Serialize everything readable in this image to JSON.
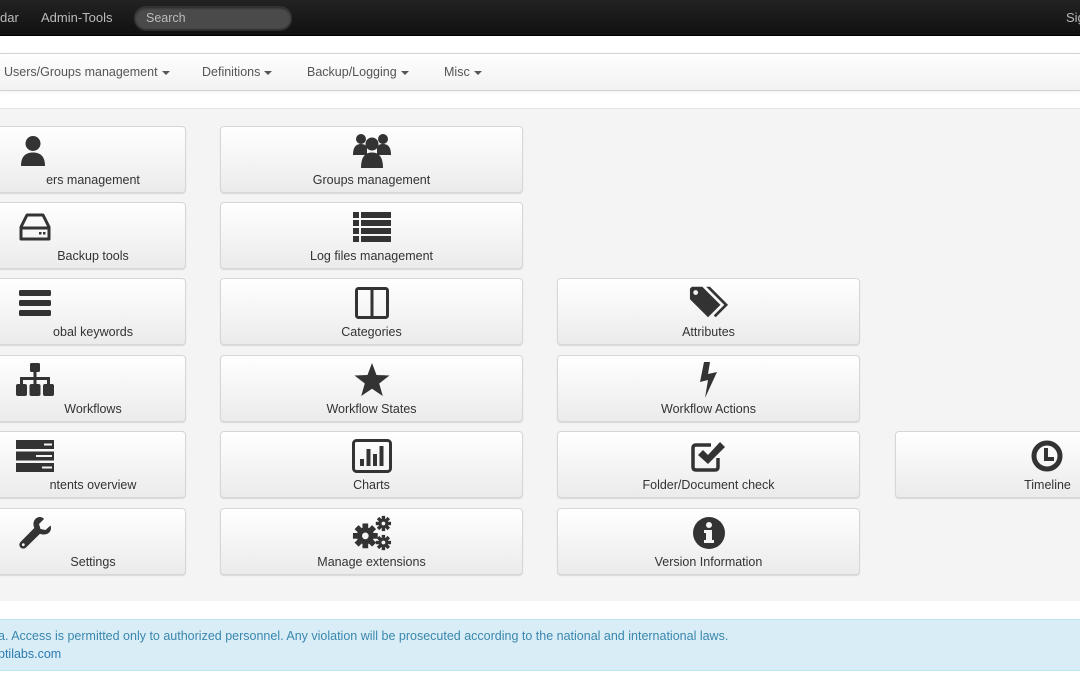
{
  "topnav": {
    "links": [
      {
        "label": "dar"
      },
      {
        "label": "Admin-Tools"
      }
    ],
    "search_placeholder": "Search",
    "signout_label": "Sig"
  },
  "subnav": {
    "menus": [
      {
        "label": "Users/Groups management"
      },
      {
        "label": "Definitions"
      },
      {
        "label": "Backup/Logging"
      },
      {
        "label": "Misc"
      }
    ]
  },
  "tiles": [
    {
      "label": "ers management",
      "icon": "user-icon"
    },
    {
      "label": "Groups management",
      "icon": "group-icon"
    },
    {
      "label": "Backup tools",
      "icon": "hdd-icon"
    },
    {
      "label": "Log files management",
      "icon": "list-icon"
    },
    {
      "label": "obal keywords",
      "icon": "reorder-icon"
    },
    {
      "label": "Categories",
      "icon": "columns-icon"
    },
    {
      "label": "Attributes",
      "icon": "tags-icon"
    },
    {
      "label": "Workflows",
      "icon": "sitemap-icon"
    },
    {
      "label": "Workflow States",
      "icon": "star-icon"
    },
    {
      "label": "Workflow Actions",
      "icon": "bolt-icon"
    },
    {
      "label": "ntents overview",
      "icon": "tasks-icon"
    },
    {
      "label": "Charts",
      "icon": "bar-chart-icon"
    },
    {
      "label": "Folder/Document check",
      "icon": "check-icon"
    },
    {
      "label": "Timeline",
      "icon": "clock-icon"
    },
    {
      "label": "Settings",
      "icon": "wrench-icon"
    },
    {
      "label": "Manage extensions",
      "icon": "cogs-icon"
    },
    {
      "label": "Version Information",
      "icon": "info-sign-icon"
    }
  ],
  "footer": {
    "notice": "a. Access is permitted only to authorized personnel. Any violation will be prosecuted according to the national and international laws.",
    "link": "ptilabs.com"
  }
}
